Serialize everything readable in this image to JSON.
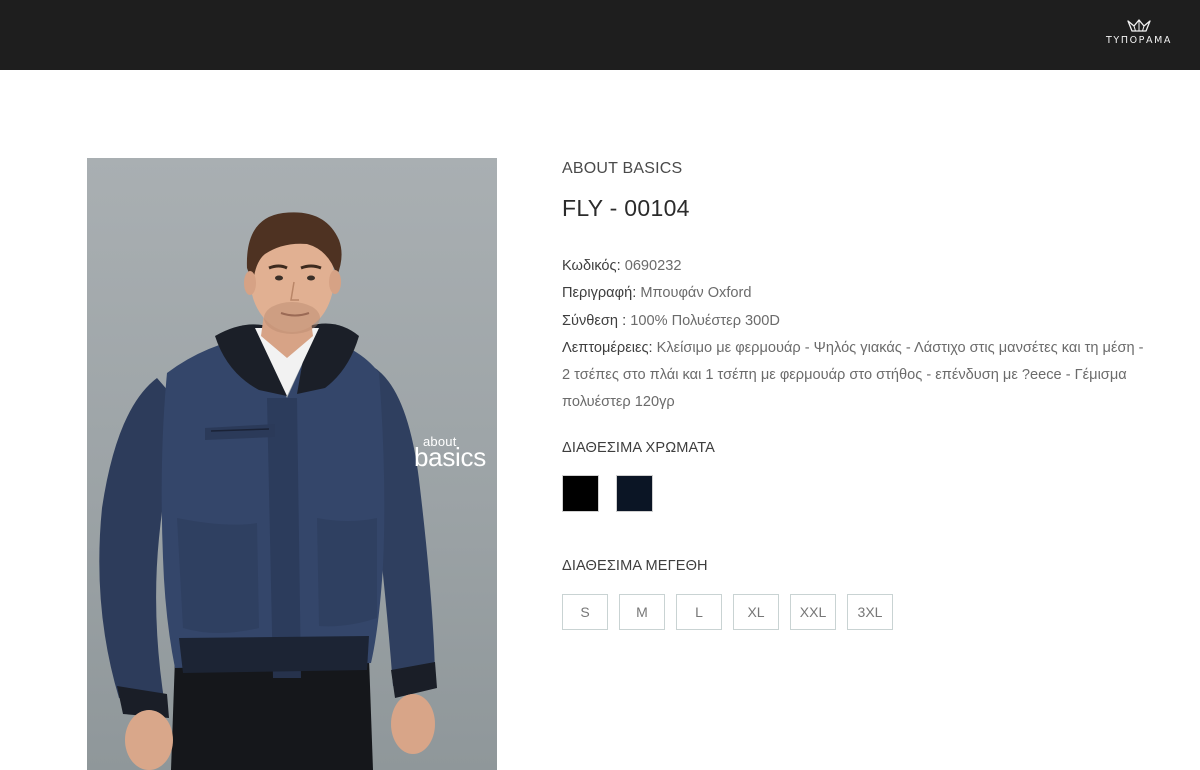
{
  "header": {
    "logo_text": "ΤΥΠΟΡΑΜΑ",
    "logo_icon": "crown-icon",
    "background": "#1e1e1e"
  },
  "product": {
    "image": {
      "description_icon": "model-jacket-photo",
      "brand_mark_top": "about",
      "brand_mark_bottom": "basics"
    },
    "brand": "ABOUT BASICS",
    "title": "FLY - 00104",
    "specs": {
      "code_label": "Κωδικός:",
      "code_value": "0690232",
      "description_label": "Περιγραφή:",
      "description_value": "Μπουφάν Oxford",
      "composition_label": "Σύνθεση :",
      "composition_value": "100% Πολυέστερ 300D",
      "details_label": "Λεπτομέρειες:",
      "details_value": "Κλείσιμο με φερμουάρ - Ψηλός γιακάς - Λάστιχο στις μανσέτες και τη μέση - 2 τσέπες στο πλάι και 1 τσέπη με φερμουάρ στο στήθος - επένδυση με ?eece - Γέμισμα πολυέστερ 120γρ"
    },
    "colors_title": "ΔΙΑΘΕΣΙΜΑ ΧΡΩΜΑΤΑ",
    "colors": [
      {
        "name": "black",
        "hex": "#000000"
      },
      {
        "name": "navy",
        "hex": "#0b1525"
      }
    ],
    "sizes_title": "ΔΙΑΘΕΣΙΜΑ ΜΕΓΕΘΗ",
    "sizes": [
      "S",
      "M",
      "L",
      "XL",
      "XXL",
      "3XL"
    ]
  }
}
